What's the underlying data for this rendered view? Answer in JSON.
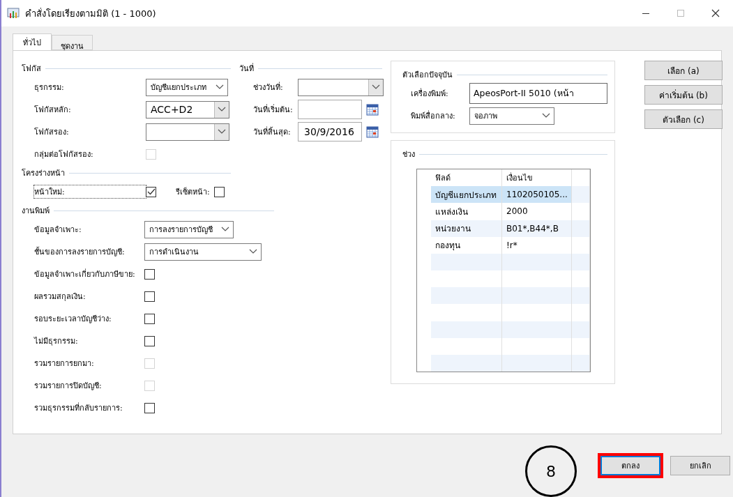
{
  "window": {
    "title": "คำสั่งโดยเรียงตามมิติ (1 - 1000)"
  },
  "tabs": [
    {
      "label": "ทั่วไป",
      "selected": true
    },
    {
      "label": "ชุดงาน",
      "selected": false
    }
  ],
  "focus": {
    "title": "โฟกัส",
    "fields": [
      {
        "kind": "dropdown",
        "label": "ธุรกรรม:",
        "value": "บัญชีแยกประเภท"
      },
      {
        "kind": "dropdown",
        "label": "โฟกัสหลัก:",
        "value": "ACC+D2"
      },
      {
        "kind": "dropdown",
        "label": "โฟกัสรอง:"
      },
      {
        "kind": "checkbox",
        "label": "กลุ่มต่อโฟกัสรอง:",
        "checked": false,
        "disabled": true
      }
    ]
  },
  "dates": {
    "title": "วันที่",
    "fields": [
      {
        "kind": "dropdown",
        "label": "ช่วงวันที่:"
      },
      {
        "kind": "date",
        "label": "วันที่เริ่มต้น:"
      },
      {
        "kind": "date",
        "label": "วันที่สิ้นสุด:",
        "value": "30/9/2016"
      }
    ]
  },
  "page_layout": {
    "title": "โครงร่างหน้า",
    "new_page": {
      "label": "หน้าใหม่:",
      "checked": true
    },
    "reset_page": {
      "label": "รีเซ็ตหน้า:",
      "checked": false
    }
  },
  "print": {
    "title": "งานพิมพ์",
    "fields": [
      {
        "kind": "dropdown",
        "label": "ข้อมูลจำเพาะ:",
        "value": "การลงรายการบัญชี"
      },
      {
        "kind": "dropdown",
        "label": "ชั้นของการลงรายการบัญชี:",
        "value": "การดำเนินงาน"
      },
      {
        "kind": "checkbox",
        "label": "ข้อมูลจำเพาะเกี่ยวกับภาษีขาย:",
        "checked": false,
        "disabled": false
      },
      {
        "kind": "checkbox",
        "label": "ผลรวมสกุลเงิน:",
        "checked": false,
        "disabled": false
      },
      {
        "kind": "checkbox",
        "label": "รอบระยะเวลาบัญชีว่าง:",
        "checked": false,
        "disabled": false
      },
      {
        "kind": "checkbox",
        "label": "ไม่มีธุรกรรม:",
        "checked": false,
        "disabled": false
      },
      {
        "kind": "checkbox",
        "label": "รวมรายการยกมา:",
        "checked": false,
        "disabled": true
      },
      {
        "kind": "checkbox",
        "label": "รวมรายการปิดบัญชี:",
        "checked": false,
        "disabled": true
      },
      {
        "kind": "checkbox",
        "label": "รวมธุรกรรมที่กลับรายการ:",
        "checked": false,
        "disabled": false
      }
    ]
  },
  "current_options": {
    "title": "ตัวเลือกปัจจุบัน",
    "printer": {
      "label": "เครื่องพิมพ์:",
      "value": "ApeosPort-II 5010 (หน้า"
    },
    "medium": {
      "label": "พิมพ์สื่อกลาง:",
      "value": "จอภาพ"
    }
  },
  "range": {
    "title": "ช่วง",
    "columns": [
      "ฟิลด์",
      "เงื่อนไข"
    ],
    "rows": [
      {
        "field": "บัญชีแยกประเภท",
        "criteria": "1102050105...",
        "selected": true
      },
      {
        "field": "แหล่งเงิน",
        "criteria": "2000",
        "selected": false
      },
      {
        "field": "หน่วยงาน",
        "criteria": "B01*,B44*,B",
        "selected": false
      },
      {
        "field": "กองทุน",
        "criteria": "!r*",
        "selected": false
      }
    ]
  },
  "side_buttons": [
    "เลือก (a)",
    "ค่าเริ่มต้น (b)",
    "ตัวเลือก (c)"
  ],
  "footer": {
    "callout": "8",
    "buttons": [
      {
        "label": "ตกลง",
        "highlighted": true
      },
      {
        "label": "ยกเลิก",
        "highlighted": false
      }
    ]
  }
}
